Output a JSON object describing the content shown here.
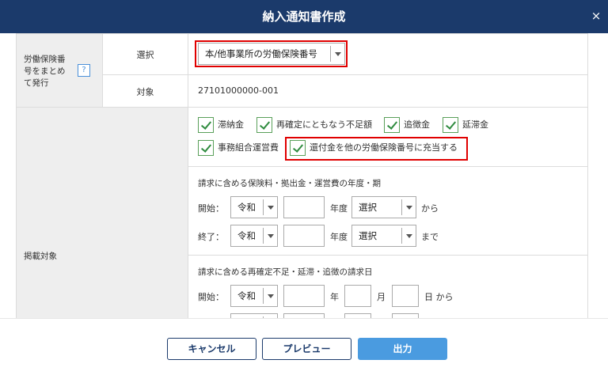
{
  "dialog": {
    "title": "納入通知書作成",
    "close_label": "×"
  },
  "group1": {
    "label_lines": [
      "労働保険番",
      "号をまとめ",
      "て発行"
    ],
    "help_label": "?",
    "row_select": {
      "label": "選択",
      "dropdown_value": "本/他事業所の労働保険番号"
    },
    "row_target": {
      "label": "対象",
      "value": "27101000000-001"
    }
  },
  "group2": {
    "label": "掲載対象",
    "checkboxes": [
      {
        "label": "滞納金",
        "checked": true
      },
      {
        "label": "再確定にともなう不足額",
        "checked": true
      },
      {
        "label": "追徴金",
        "checked": true
      },
      {
        "label": "延滞金",
        "checked": true
      },
      {
        "label": "事務組合運営費",
        "checked": true
      },
      {
        "label": "還付金を他の労働保険番号に充当する",
        "checked": true
      }
    ],
    "period_section": {
      "title": "請求に含める保険料・拠出金・運営費の年度・期",
      "start": {
        "label": "開始：",
        "era": "令和",
        "year_unit": "年度",
        "term": "選択",
        "suffix": "から"
      },
      "end": {
        "label": "終了：",
        "era": "令和",
        "year_unit": "年度",
        "term": "選択",
        "suffix": "まで"
      }
    },
    "date_section": {
      "title": "請求に含める再確定不足・延滞・追徴の請求日",
      "start": {
        "label": "開始：",
        "era": "令和",
        "year_unit": "年",
        "month_unit": "月",
        "day_suffix": "日 から"
      }
    }
  },
  "footer": {
    "cancel": "キャンセル",
    "preview": "プレビュー",
    "output": "出力"
  },
  "colors": {
    "header_bg": "#1b3a6b",
    "highlight": "#e00000",
    "primary": "#4a9be0",
    "check": "#2e8b3e"
  }
}
